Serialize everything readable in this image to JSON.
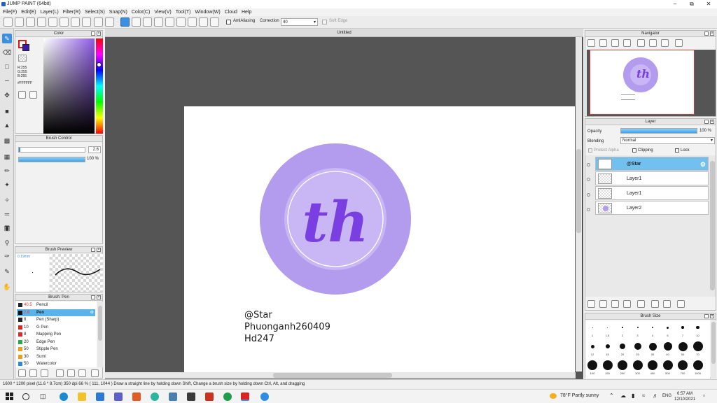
{
  "title": "JUMP PAINT (64bit)",
  "menu": [
    "File(F)",
    "Edit(E)",
    "Layer(L)",
    "Filter(R)",
    "Select(S)",
    "Snap(N)",
    "Color(C)",
    "View(V)",
    "Tool(T)",
    "Window(W)",
    "Cloud",
    "Help"
  ],
  "toolbar": {
    "antialiasing": "AntiAliasing",
    "correction_label": "Correction",
    "correction_value": "40",
    "soft_edge": "Soft Edge"
  },
  "document_tab": "Untitled",
  "color_panel": {
    "title": "Color",
    "r": "R:255",
    "g": "G:255",
    "b": "B:255",
    "hex": "#FFFFFF"
  },
  "brush_control": {
    "title": "Brush Control",
    "size": "2.6",
    "opacity": "100 %"
  },
  "brush_preview": {
    "title": "Brush Preview",
    "size": "0.19mm"
  },
  "brush_list": {
    "title": "Brush: Pen",
    "items": [
      {
        "size": "40.5",
        "name": "Pencil",
        "color": "#222222"
      },
      {
        "size": "2.6",
        "name": "Pen",
        "color": "#111111",
        "selected": true
      },
      {
        "size": "8",
        "name": "Pen (Sharp)",
        "color": "#222222"
      },
      {
        "size": "10",
        "name": "G Pen",
        "color": "#d92b2b"
      },
      {
        "size": "8",
        "name": "Mapping Pen",
        "color": "#d92b2b"
      },
      {
        "size": "20",
        "name": "Edge Pen",
        "color": "#2aa84a"
      },
      {
        "size": "50",
        "name": "Stipple Pen",
        "color": "#e6a21e"
      },
      {
        "size": "30",
        "name": "Sumi",
        "color": "#e6a21e"
      },
      {
        "size": "50",
        "name": "Watercolor",
        "color": "#2a8ad9"
      }
    ]
  },
  "navigator": {
    "title": "Navigator"
  },
  "layer_panel": {
    "title": "Layer",
    "opacity_label": "Opacity",
    "opacity_value": "100 %",
    "blending_label": "Blending",
    "blending_value": "Normal",
    "protect_alpha": "Protect Alpha",
    "clipping": "Clipping",
    "lock": "Lock",
    "layers": [
      {
        "name": "@Star",
        "selected": true
      },
      {
        "name": "Layer1",
        "selected": false
      },
      {
        "name": "Layer1",
        "selected": false
      },
      {
        "name": "Layer2",
        "selected": false
      }
    ]
  },
  "brush_size": {
    "title": "Brush Size",
    "row1": [
      "1",
      "1.5",
      "2",
      "3",
      "4",
      "5",
      "7",
      "10"
    ],
    "row2": [
      "12",
      "15",
      "20",
      "25",
      "30",
      "40",
      "50",
      "70"
    ],
    "row3": [
      "100",
      "150",
      "200",
      "300",
      "400",
      "500",
      "700",
      "1000"
    ]
  },
  "artwork": {
    "logo_text": "th",
    "lines": [
      "@Star",
      "Phuonganh260409",
      "Hd247"
    ],
    "circle_color": "#b39bee",
    "inner_color": "#c9b7f5",
    "letter_color": "#7a3fe0"
  },
  "status": "1600 * 1200 pixel  (11.6 * 8.7cm)  350 dpi  66 %  ( 111, 1044 )  Draw a straight line by holding down Shift, Change a brush size by holding down Ctrl, Alt, and dragging",
  "taskbar": {
    "weather": "78°F  Partly sunny",
    "lang": "ENG",
    "time": "6:57 AM",
    "date": "12/10/2021"
  }
}
